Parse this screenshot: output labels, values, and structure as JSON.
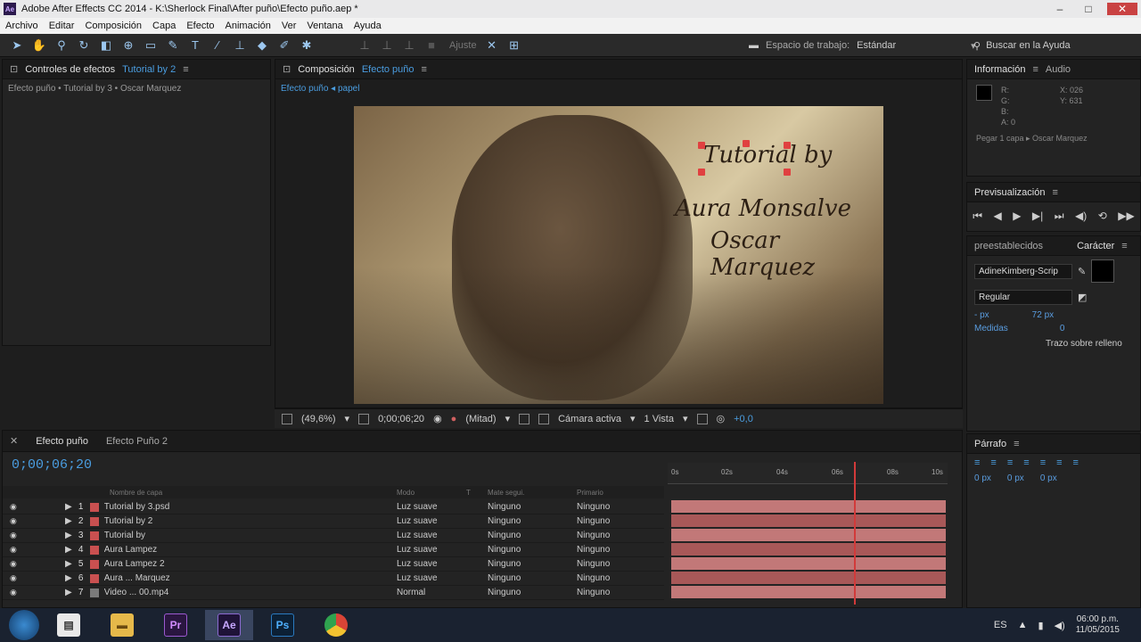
{
  "window": {
    "title": "Adobe After Effects CC 2014 - K:\\Sherlock Final\\After puño\\Efecto puño.aep *",
    "logo": "Ae"
  },
  "menu": [
    "Archivo",
    "Editar",
    "Composición",
    "Capa",
    "Efecto",
    "Animación",
    "Ver",
    "Ventana",
    "Ayuda"
  ],
  "toolbar": {
    "snap_label": "Ajuste",
    "workspace_label": "Espacio de trabajo:",
    "workspace_value": "Estándar",
    "help_placeholder": "Buscar en la Ayuda"
  },
  "effects_panel": {
    "tab": "Controles de efectos",
    "tab_comp": "Tutorial by 2",
    "breadcrumb": "Efecto puño • Tutorial by 3 • Oscar Marquez"
  },
  "composition": {
    "tab": "Composición",
    "tab_name": "Efecto puño",
    "subtab": "Efecto puño ◂ papel",
    "text_lines": [
      "Tutorial by",
      "Aura Monsalve",
      "Oscar Marquez"
    ],
    "zoom": "(49,6%)",
    "timecode": "0;00;06;20",
    "resolution": "(Mitad)",
    "camera": "Cámara activa",
    "views": "1 Vista",
    "exposure": "+0,0"
  },
  "info_panel": {
    "tab": "Información",
    "tab2": "Audio",
    "r": "R:",
    "g": "G:",
    "b": "B:",
    "a": "A: 0",
    "x": "X: 026",
    "y": "Y: 631",
    "line": "Pegar 1 capa ▸ Oscar Marquez"
  },
  "preview_panel": {
    "tab": "Previsualización"
  },
  "character_panel": {
    "tab_presets": "preestablecidos",
    "tab": "Carácter",
    "font": "AdineKimberg-Scrip",
    "style": "Regular",
    "size": "- px",
    "leading": "72 px",
    "tracking_label": "Medidas",
    "tracking_value": "0",
    "stroke": "Trazo sobre relleno"
  },
  "paragraph_panel": {
    "tab": "Párrafo",
    "indent": "0 px"
  },
  "timeline": {
    "tabs": [
      "Efecto puño",
      "Efecto Puño 2"
    ],
    "timecode": "0;00;06;20",
    "headers": [
      "Nombre de capa",
      "Modo",
      "T",
      "Mate segui.",
      "Primario"
    ],
    "layers": [
      {
        "num": "1",
        "name": "Tutorial by 3.psd",
        "mode": "Luz suave",
        "trk": "Ninguno",
        "par": "Ninguno",
        "color": "#c95050"
      },
      {
        "num": "2",
        "name": "Tutorial by 2",
        "mode": "Luz suave",
        "trk": "Ninguno",
        "par": "Ninguno",
        "color": "#c95050"
      },
      {
        "num": "3",
        "name": "Tutorial by",
        "mode": "Luz suave",
        "trk": "Ninguno",
        "par": "Ninguno",
        "color": "#c95050"
      },
      {
        "num": "4",
        "name": "Aura Lampez",
        "mode": "Luz suave",
        "trk": "Ninguno",
        "par": "Ninguno",
        "color": "#c95050"
      },
      {
        "num": "5",
        "name": "Aura Lampez 2",
        "mode": "Luz suave",
        "trk": "Ninguno",
        "par": "Ninguno",
        "color": "#c95050"
      },
      {
        "num": "6",
        "name": "Aura ... Marquez",
        "mode": "Luz suave",
        "trk": "Ninguno",
        "par": "Ninguno",
        "color": "#c95050"
      },
      {
        "num": "7",
        "name": "Video ... 00.mp4",
        "mode": "Normal",
        "trk": "Ninguno",
        "par": "Ninguno",
        "color": "#7a7a7a"
      }
    ],
    "ruler": [
      "0s",
      "02s",
      "04s",
      "06s",
      "08s",
      "10s"
    ]
  },
  "taskbar": {
    "apps": [
      "Explorer",
      "Folder",
      "Pr",
      "Ae",
      "Ps",
      "Chrome"
    ],
    "lang": "ES",
    "time": "06:00 p.m.",
    "date": "11/05/2015"
  }
}
